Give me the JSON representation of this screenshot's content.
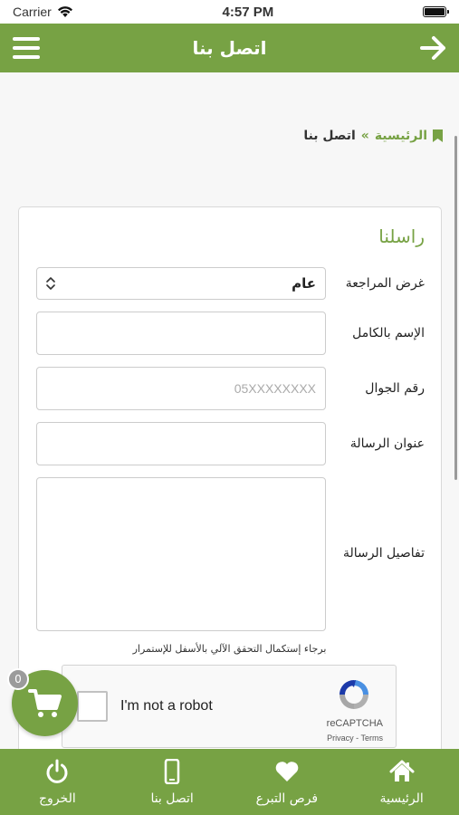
{
  "status_bar": {
    "carrier": "Carrier",
    "time": "4:57 PM"
  },
  "header": {
    "title": "اتصل بنا"
  },
  "breadcrumb": {
    "home": "الرئيسية",
    "separator": "»",
    "current": "اتصل بنا"
  },
  "form": {
    "title": "راسلنا",
    "purpose_label": "غرض المراجعة",
    "purpose_value": "عام",
    "name_label": "الإسم بالكامل",
    "name_value": "",
    "phone_label": "رقم الجوال",
    "phone_placeholder": "05XXXXXXXX",
    "subject_label": "عنوان الرسالة",
    "subject_value": "",
    "details_label": "تفاصيل الرسالة",
    "details_value": "",
    "captcha_note": "برجاء إستكمال التحقق الآلي بالأسفل للإستمرار"
  },
  "recaptcha": {
    "label": "I'm not a robot",
    "brand": "reCAPTCHA",
    "links": "Privacy - Terms"
  },
  "cart": {
    "count": "0"
  },
  "tabs": [
    {
      "label": "الرئيسية",
      "icon": "home-icon"
    },
    {
      "label": "فرص التبرع",
      "icon": "heart-icon"
    },
    {
      "label": "اتصل بنا",
      "icon": "phone-icon"
    },
    {
      "label": "الخروج",
      "icon": "power-icon"
    }
  ],
  "colors": {
    "brand": "#77a244",
    "badge": "#9b9b9b"
  }
}
